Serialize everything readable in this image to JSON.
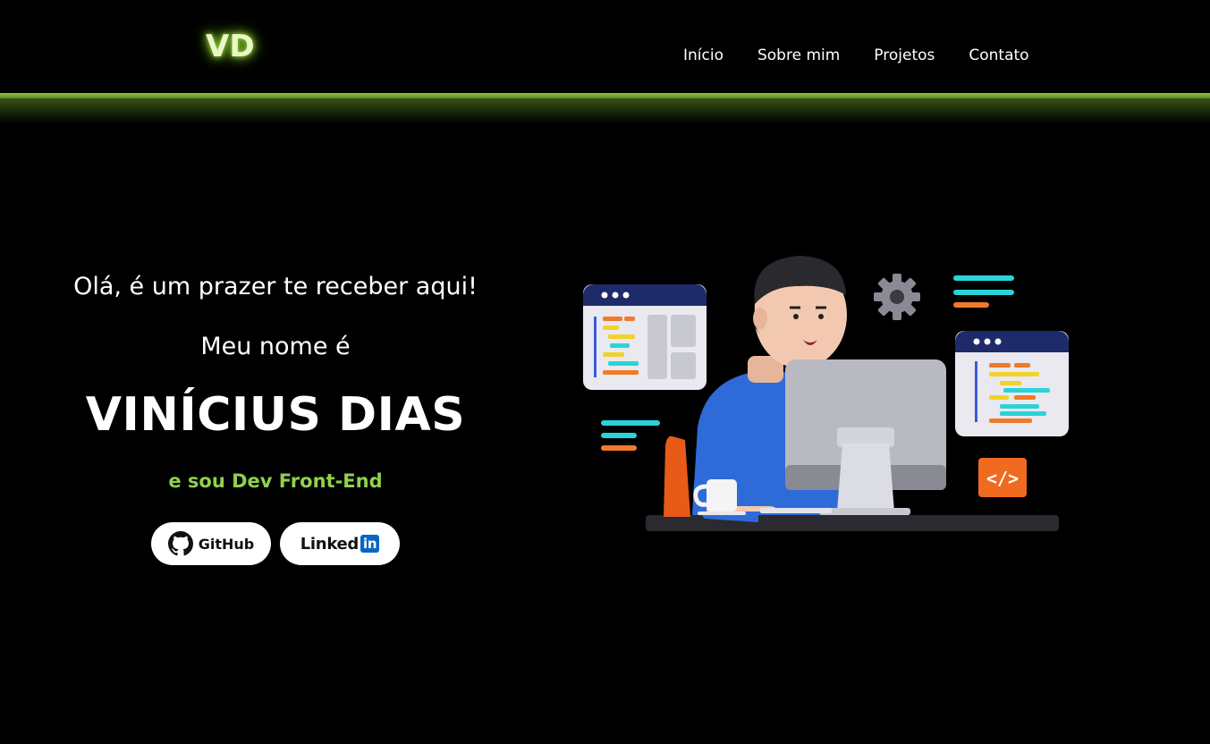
{
  "header": {
    "logo": "VD",
    "nav": [
      "Início",
      "Sobre mim",
      "Projetos",
      "Contato"
    ]
  },
  "hero": {
    "greeting": "Olá, é um prazer te receber aqui!",
    "intro": "Meu nome é",
    "name": "VINÍCIUS DIAS",
    "role": "e sou Dev Front-End",
    "buttons": {
      "github": "GitHub",
      "linkedin_prefix": "Linked",
      "linkedin_box": "in"
    }
  },
  "illustration": {
    "code_tag": "</>"
  },
  "colors": {
    "background": "#000000",
    "accent": "#8fd14f",
    "glow": "#89c33a",
    "linkedin": "#0a66c2"
  },
  "icons": [
    "github-icon",
    "linkedin-icon",
    "gear-icon",
    "code-icon"
  ]
}
